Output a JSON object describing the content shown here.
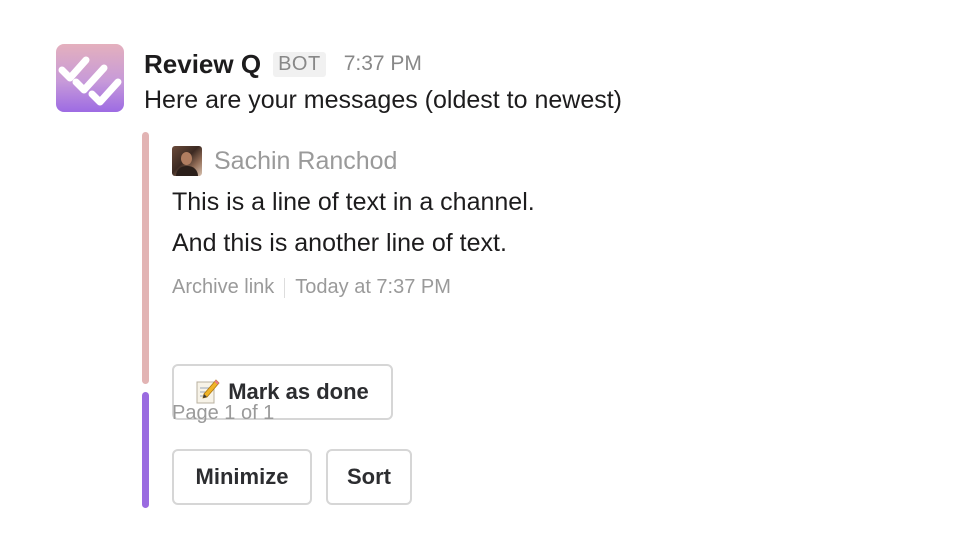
{
  "message": {
    "bot_name": "Review Q",
    "bot_badge": "BOT",
    "timestamp": "7:37 PM",
    "intro_text": "Here are your messages (oldest to newest)"
  },
  "attachment": {
    "author_name": "Sachin Ranchod",
    "lines": [
      "This is a line of text in a channel.",
      "And this is another line of text."
    ],
    "archive_link": "Archive link",
    "posted_time": "Today at 7:37 PM",
    "mark_done_icon": "memo-pencil-icon",
    "mark_done_label": "Mark as done",
    "bar_color": "#e2b4b4"
  },
  "pagination": {
    "page_info": "Page 1 of 1",
    "minimize_label": "Minimize",
    "sort_label": "Sort",
    "bar_color": "#9a6be0"
  }
}
